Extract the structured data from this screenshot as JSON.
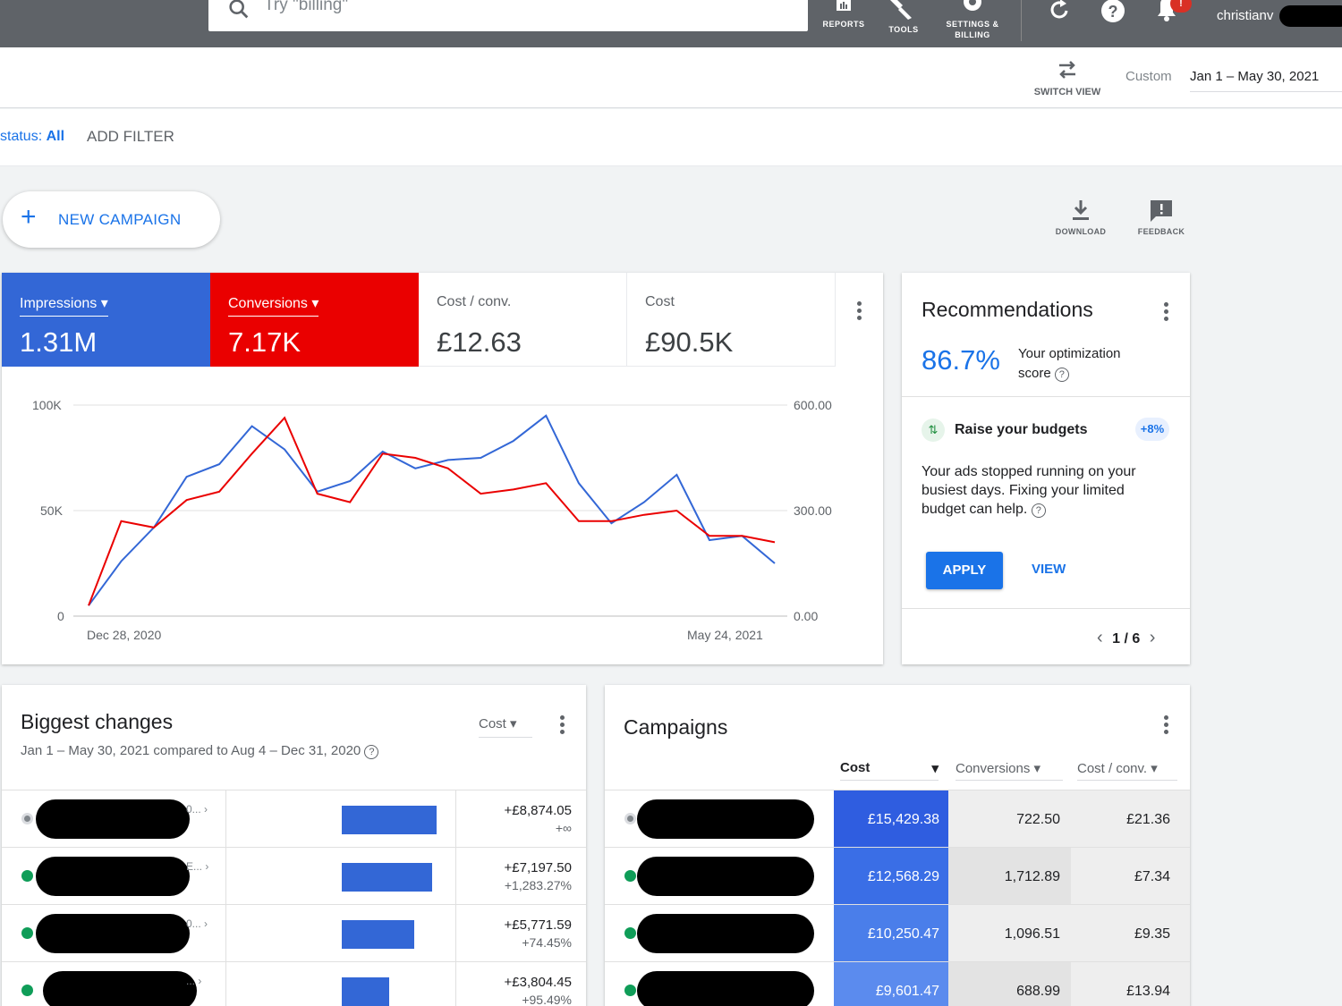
{
  "topbar": {
    "search_placeholder": "Try \"billing\"",
    "reports_label": "REPORTS",
    "tools_label": "TOOLS",
    "settings_label_1": "SETTINGS &",
    "settings_label_2": "BILLING",
    "notification_count": "!",
    "user": "christianv"
  },
  "datebar": {
    "switch_view": "SWITCH VIEW",
    "custom_label": "Custom",
    "range": "Jan 1 – May 30, 2021"
  },
  "filterbar": {
    "status_label": "status:",
    "status_value": "All",
    "add_filter": "ADD FILTER"
  },
  "new_campaign": "NEW CAMPAIGN",
  "download_label": "DOWNLOAD",
  "feedback_label": "FEEDBACK",
  "metrics": [
    {
      "label": "Impressions",
      "value": "1.31M",
      "color": "#3367d6"
    },
    {
      "label": "Conversions",
      "value": "7.17K",
      "color": "#ea0000"
    },
    {
      "label": "Cost / conv.",
      "value": "£12.63"
    },
    {
      "label": "Cost",
      "value": "£90.5K"
    }
  ],
  "chart_data": {
    "type": "line",
    "x_start": "Dec 28, 2020",
    "x_end": "May 24, 2021",
    "left_axis_ticks": [
      "100K",
      "50K",
      "0"
    ],
    "right_axis_ticks": [
      "600.00",
      "300.00",
      "0.00"
    ],
    "ylim_left": [
      0,
      100000
    ],
    "ylim_right": [
      0,
      600
    ],
    "grid": true,
    "series": [
      {
        "name": "Impressions",
        "color": "#3367d6",
        "axis": "left",
        "values": [
          5000,
          26000,
          42000,
          66000,
          72000,
          90000,
          79000,
          59000,
          64000,
          78000,
          70000,
          74000,
          75000,
          83000,
          95000,
          63000,
          44000,
          54000,
          67000,
          36000,
          38000,
          25000
        ]
      },
      {
        "name": "Conversions",
        "color": "#ea0000",
        "axis": "left",
        "values": [
          5000,
          45000,
          42000,
          55000,
          59000,
          77000,
          94000,
          58000,
          54000,
          77000,
          75000,
          70000,
          58000,
          60000,
          63000,
          45000,
          45000,
          48000,
          50000,
          38000,
          38000,
          35000
        ]
      }
    ]
  },
  "recommendations": {
    "title": "Recommendations",
    "score": "86.7%",
    "score_label_1": "Your optimization",
    "score_label_2": "score",
    "item_title": "Raise your budgets",
    "item_pct": "+8%",
    "item_body": "Your ads stopped running on your busiest days. Fixing your limited budget can help.",
    "apply": "APPLY",
    "view": "VIEW",
    "pager": "1 / 6"
  },
  "biggest_changes": {
    "title": "Biggest changes",
    "subtitle": "Jan 1 – May 30, 2021 compared to Aug 4 – Dec 31, 2020",
    "metric": "Cost",
    "rows": [
      {
        "trunc": "0... ›",
        "value": "+£8,874.05",
        "change": "+∞",
        "bar": 1.0,
        "status": "paused"
      },
      {
        "trunc": "E... ›",
        "value": "+£7,197.50",
        "change": "+1,283.27%",
        "bar": 0.95,
        "status": "enabled"
      },
      {
        "trunc": "0... ›",
        "value": "+£5,771.59",
        "change": "+74.45%",
        "bar": 0.76,
        "status": "enabled"
      },
      {
        "trunc": "... ›",
        "value": "+£3,804.45",
        "change": "+95.49%",
        "bar": 0.5,
        "status": "enabled"
      }
    ]
  },
  "campaigns": {
    "title": "Campaigns",
    "headers": [
      "Cost",
      "Conversions",
      "Cost / conv."
    ],
    "rows": [
      {
        "cost": "£15,429.38",
        "conversions": "722.50",
        "cost_conv": "£21.36",
        "status": "paused",
        "shade": "#2f5de0"
      },
      {
        "cost": "£12,568.29",
        "conversions": "1,712.89",
        "cost_conv": "£7.34",
        "status": "enabled",
        "shade": "#3a6ee6"
      },
      {
        "cost": "£10,250.47",
        "conversions": "1,096.51",
        "cost_conv": "£9.35",
        "status": "enabled",
        "shade": "#4a7eea"
      },
      {
        "cost": "£9,601.47",
        "conversions": "688.99",
        "cost_conv": "£13.94",
        "status": "enabled",
        "shade": "#5b8bee"
      }
    ]
  }
}
